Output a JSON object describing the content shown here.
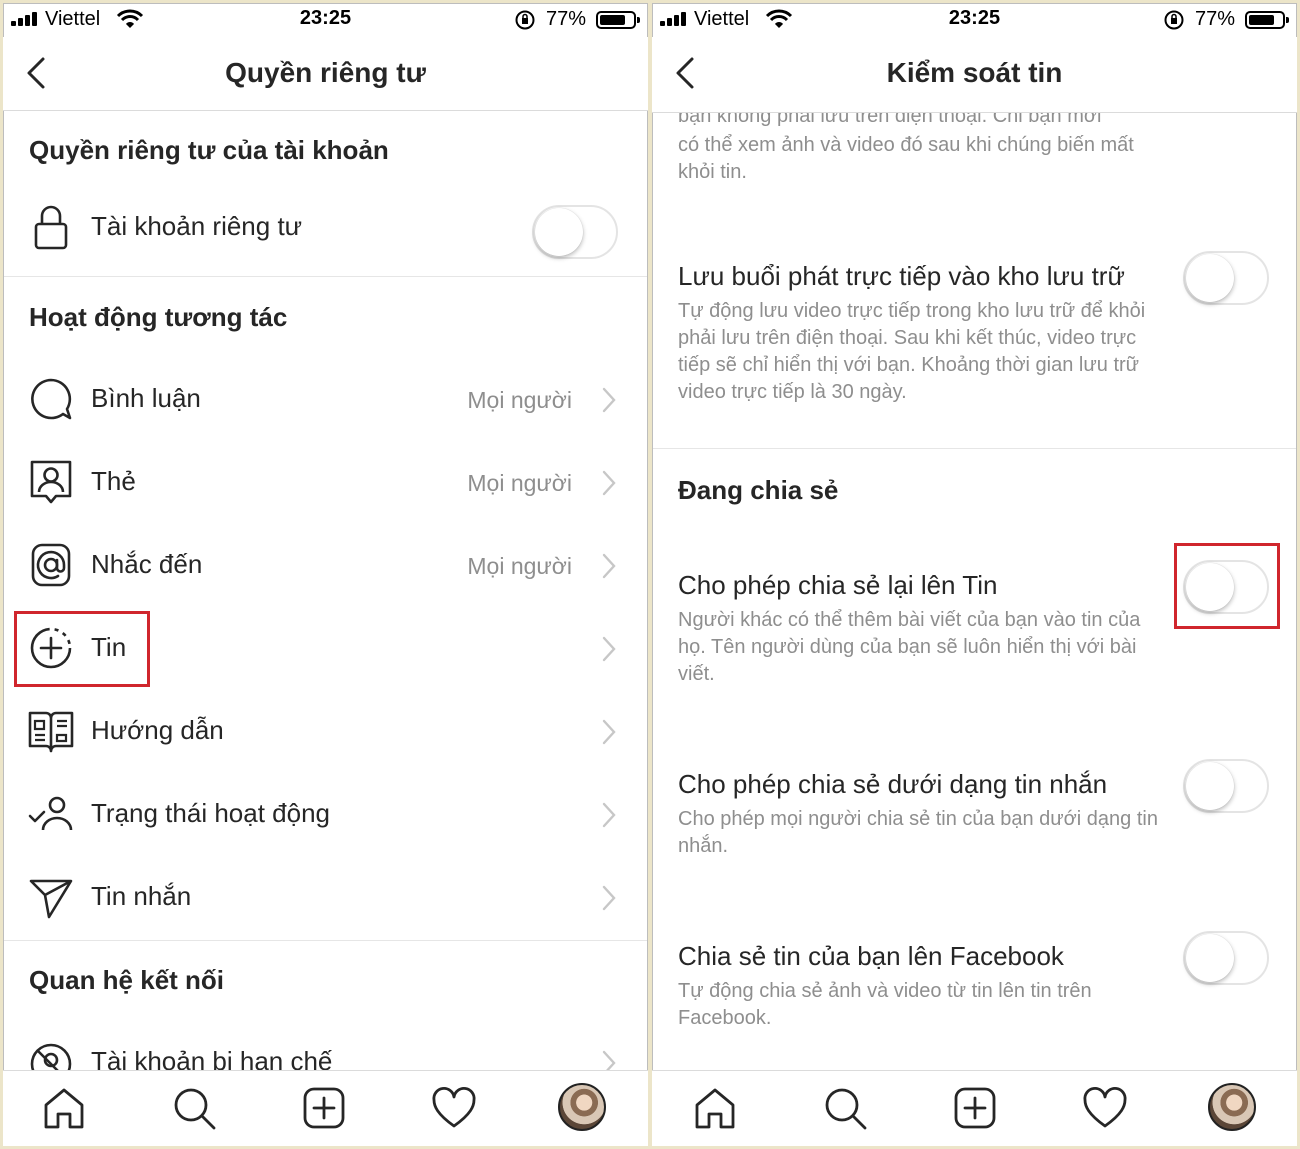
{
  "status_bar": {
    "carrier": "Viettel",
    "time": "23:25",
    "battery": "77%",
    "battery_level": 0.77
  },
  "left_screen": {
    "title": "Quyền riêng tư",
    "account_section": {
      "title": "Quyền riêng tư của tài khoản",
      "private_account": {
        "label": "Tài khoản riêng tư",
        "enabled": false
      }
    },
    "interactions_section": {
      "title": "Hoạt động tương tác",
      "items": [
        {
          "label": "Bình luận",
          "value": "Mọi người"
        },
        {
          "label": "Thẻ",
          "value": "Mọi người"
        },
        {
          "label": "Nhắc đến",
          "value": "Mọi người"
        },
        {
          "label": "Tin",
          "value": ""
        },
        {
          "label": "Hướng dẫn",
          "value": ""
        },
        {
          "label": "Trạng thái hoạt động",
          "value": ""
        },
        {
          "label": "Tin nhắn",
          "value": ""
        }
      ]
    },
    "connections_section": {
      "title": "Quan hệ kết nối",
      "items": [
        {
          "label": "Tài khoản bị hạn chế"
        }
      ]
    }
  },
  "right_screen": {
    "title": "Kiểm soát tin",
    "top_fragment": {
      "line1": "bạn không phải lưu trên điện thoại. Chỉ bạn mới",
      "line2": "có thể xem ảnh và video đó sau khi chúng biến mất khỏi tin."
    },
    "live_archive": {
      "title": "Lưu buổi phát trực tiếp vào kho lưu trữ",
      "description": "Tự động lưu video trực tiếp trong kho lưu trữ để khỏi phải lưu trên điện thoại. Sau khi kết thúc, video trực tiếp sẽ chỉ hiển thị với bạn. Khoảng thời gian lưu trữ video trực tiếp là 30 ngày.",
      "enabled": false
    },
    "sharing_section": {
      "title": "Đang chia sẻ",
      "items": [
        {
          "title": "Cho phép chia sẻ lại lên Tin",
          "description": "Người khác có thể thêm bài viết của bạn vào tin của họ. Tên người dùng của bạn sẽ luôn hiển thị với bài viết.",
          "enabled": false
        },
        {
          "title": "Cho phép chia sẻ dưới dạng tin nhắn",
          "description": "Cho phép mọi người chia sẻ tin của bạn dưới dạng tin nhắn.",
          "enabled": false
        },
        {
          "title": "Chia sẻ tin của bạn lên Facebook",
          "description": "Tự động chia sẻ ảnh và video từ tin lên tin trên Facebook.",
          "enabled": false
        }
      ]
    }
  },
  "bottom_nav": {
    "tabs": [
      "home-icon",
      "search-icon",
      "new-post-icon",
      "activity-heart-icon",
      "profile-avatar"
    ]
  },
  "highlight_color": "#d0262d"
}
